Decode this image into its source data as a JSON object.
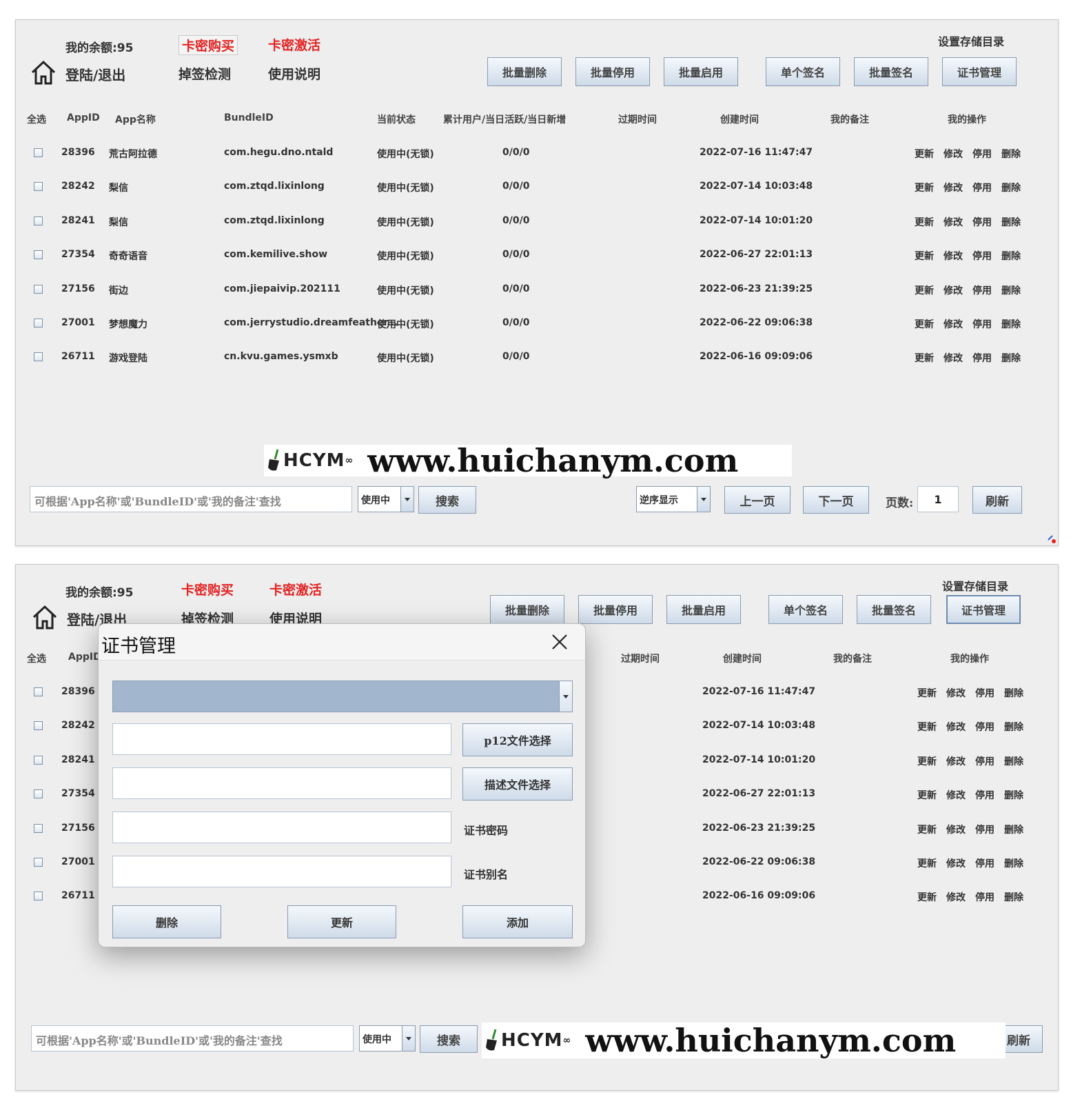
{
  "header": {
    "balance": "我的余额:95",
    "buy_card": "卡密购买",
    "activate_card": "卡密激活",
    "login_logout": "登陆/退出",
    "drop_check": "掉签检测",
    "instructions": "使用说明",
    "storage_dir": "设置存储目录"
  },
  "toolbar": {
    "batch_delete": "批量删除",
    "batch_disable": "批量停用",
    "batch_enable": "批量启用",
    "single_sign": "单个签名",
    "batch_sign": "批量签名",
    "cert_manage": "证书管理"
  },
  "columns": {
    "select_all": "全选",
    "appid": "AppID",
    "app_name": "App名称",
    "bundle_id": "BundleID",
    "status": "当前状态",
    "users": "累计用户/当日活跃/当日新增",
    "expire": "过期时间",
    "created": "创建时间",
    "note": "我的备注",
    "ops": "我的操作"
  },
  "rows": [
    {
      "appid": "28396",
      "name": "荒古阿拉德",
      "bundle": "com.hegu.dno.ntald",
      "status": "使用中(无锁)",
      "users": "0/0/0",
      "created": "2022-07-16 11:47:47"
    },
    {
      "appid": "28242",
      "name": "梨信",
      "bundle": "com.ztqd.lixinlong",
      "status": "使用中(无锁)",
      "users": "0/0/0",
      "created": "2022-07-14 10:03:48"
    },
    {
      "appid": "28241",
      "name": "梨信",
      "bundle": "com.ztqd.lixinlong",
      "status": "使用中(无锁)",
      "users": "0/0/0",
      "created": "2022-07-14 10:01:20"
    },
    {
      "appid": "27354",
      "name": "奇奇语音",
      "bundle": "com.kemilive.show",
      "status": "使用中(无锁)",
      "users": "0/0/0",
      "created": "2022-06-27 22:01:13"
    },
    {
      "appid": "27156",
      "name": "街边",
      "bundle": "com.jiepaivip.202111",
      "status": "使用中(无锁)",
      "users": "0/0/0",
      "created": "2022-06-23 21:39:25"
    },
    {
      "appid": "27001",
      "name": "梦想魔力",
      "bundle": "com.jerrystudio.dreamfeather...",
      "status": "使用中(无锁)",
      "users": "0/0/0",
      "created": "2022-06-22 09:06:38"
    },
    {
      "appid": "26711",
      "name": "游戏登陆",
      "bundle": "cn.kvu.games.ysmxb",
      "status": "使用中(无锁)",
      "users": "0/0/0",
      "created": "2022-06-16 09:09:06"
    }
  ],
  "ops": {
    "update": "更新",
    "edit": "修改",
    "disable": "停用",
    "delete": "删除"
  },
  "footer": {
    "search_placeholder": "可根据'App名称'或'BundleID'或'我的备注'查找",
    "status_filter": "使用中",
    "search": "搜索",
    "order": "逆序显示",
    "prev": "上一页",
    "next": "下一页",
    "page_label": "页数:",
    "page_value": "1",
    "refresh": "刷新"
  },
  "watermark": {
    "logo": "HCYM",
    "url": "www.huichanym.com"
  },
  "modal": {
    "title": "证书管理",
    "p12_select": "p12文件选择",
    "profile_select": "描述文件选择",
    "cert_password": "证书密码",
    "cert_alias": "证书别名",
    "delete": "删除",
    "update": "更新",
    "add": "添加"
  },
  "colors": {
    "accent_red": "#e32424",
    "window_bg": "#eeeeee",
    "button_gradient_bottom": "#cfdbe9",
    "combo_selected": "#a2b7ce"
  }
}
